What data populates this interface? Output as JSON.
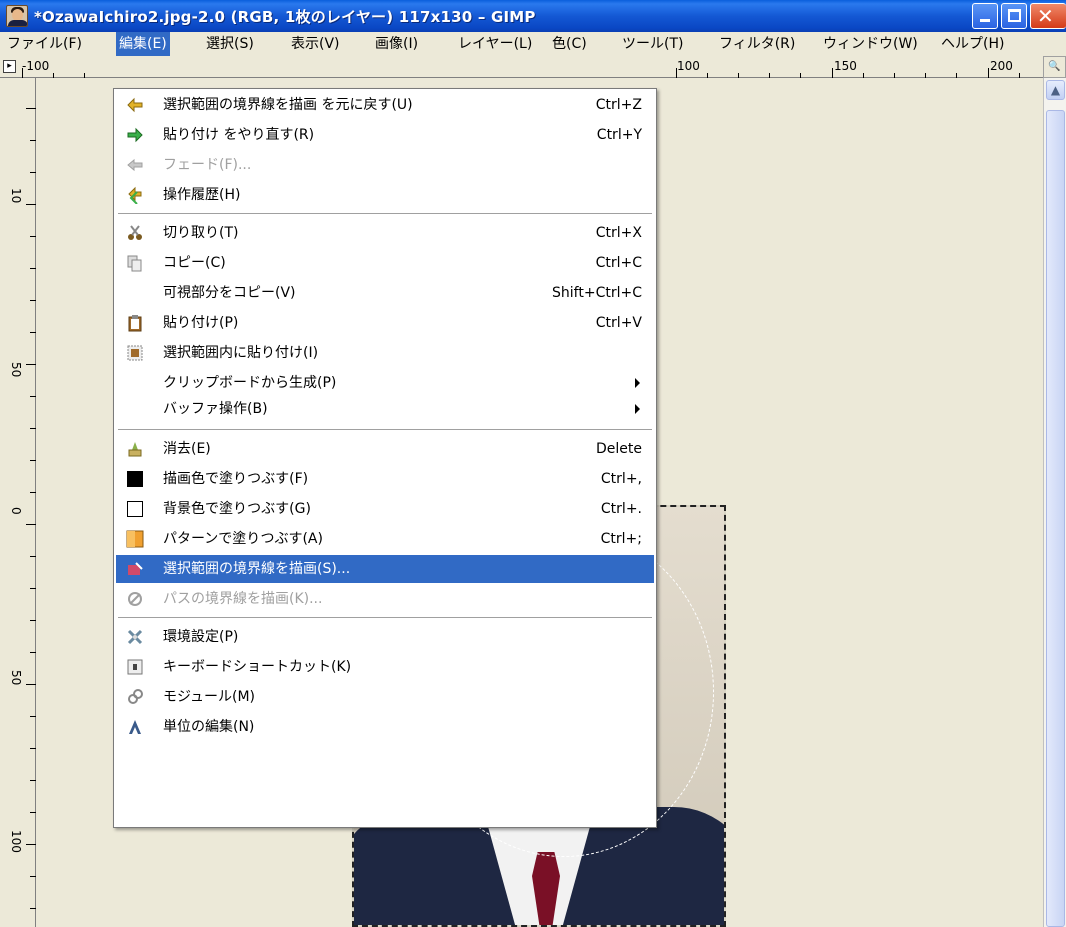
{
  "window": {
    "title": "*OzawaIchiro2.jpg-2.0 (RGB, 1枚のレイヤー) 117x130 – GIMP"
  },
  "menubar": {
    "items": [
      {
        "label": "ファイル(F)"
      },
      {
        "label": "編集(E)"
      },
      {
        "label": "選択(S)"
      },
      {
        "label": "表示(V)"
      },
      {
        "label": "画像(I)"
      },
      {
        "label": "レイヤー(L)"
      },
      {
        "label": "色(C)"
      },
      {
        "label": "ツール(T)"
      },
      {
        "label": "フィルタ(R)"
      },
      {
        "label": "ウィンドウ(W)"
      },
      {
        "label": "ヘルプ(H)"
      }
    ],
    "active": "編集(E)"
  },
  "rulers": {
    "top_labels": [
      "-100",
      "100",
      "150",
      "200"
    ],
    "left_labels": [
      "10",
      "50",
      "0",
      "50",
      "100"
    ]
  },
  "edit_menu": {
    "items": [
      {
        "label": "選択範囲の境界線を描画 を元に戻す(U)",
        "shortcut": "Ctrl+Z",
        "icon": "undo-icon"
      },
      {
        "label": "貼り付け をやり直す(R)",
        "shortcut": "Ctrl+Y",
        "icon": "redo-icon"
      },
      {
        "label": "フェード(F)...",
        "shortcut": "",
        "icon": "fade-icon",
        "disabled": true
      },
      {
        "label": "操作履歴(H)",
        "shortcut": "",
        "icon": "history-icon"
      },
      {
        "label": "切り取り(T)",
        "shortcut": "Ctrl+X",
        "icon": "cut-icon"
      },
      {
        "label": "コピー(C)",
        "shortcut": "Ctrl+C",
        "icon": "copy-icon"
      },
      {
        "label": "可視部分をコピー(V)",
        "shortcut": "Shift+Ctrl+C",
        "icon": ""
      },
      {
        "label": "貼り付け(P)",
        "shortcut": "Ctrl+V",
        "icon": "paste-icon"
      },
      {
        "label": "選択範囲内に貼り付け(I)",
        "shortcut": "",
        "icon": "paste-into-icon"
      },
      {
        "label": "クリップボードから生成(P)",
        "shortcut": "",
        "icon": "",
        "submenu": true
      },
      {
        "label": "バッファ操作(B)",
        "shortcut": "",
        "icon": "",
        "submenu": true
      },
      {
        "label": "消去(E)",
        "shortcut": "Delete",
        "icon": "clear-icon"
      },
      {
        "label": "描画色で塗りつぶす(F)",
        "shortcut": "Ctrl+,",
        "icon": "fg-fill-icon"
      },
      {
        "label": "背景色で塗りつぶす(G)",
        "shortcut": "Ctrl+.",
        "icon": "bg-fill-icon"
      },
      {
        "label": "パターンで塗りつぶす(A)",
        "shortcut": "Ctrl+;",
        "icon": "pattern-fill-icon"
      },
      {
        "label": "選択範囲の境界線を描画(S)...",
        "shortcut": "",
        "icon": "stroke-selection-icon",
        "highlighted": true
      },
      {
        "label": "パスの境界線を描画(K)...",
        "shortcut": "",
        "icon": "stroke-path-icon",
        "disabled": true
      },
      {
        "label": "環境設定(P)",
        "shortcut": "",
        "icon": "preferences-icon"
      },
      {
        "label": "キーボードショートカット(K)",
        "shortcut": "",
        "icon": "keyboard-icon"
      },
      {
        "label": "モジュール(M)",
        "shortcut": "",
        "icon": "module-icon"
      },
      {
        "label": "単位の編集(N)",
        "shortcut": "",
        "icon": "units-icon"
      }
    ]
  },
  "colors": {
    "highlight": "#316ac5",
    "titlebar": "#0a47c4",
    "chrome": "#ece9d8"
  }
}
